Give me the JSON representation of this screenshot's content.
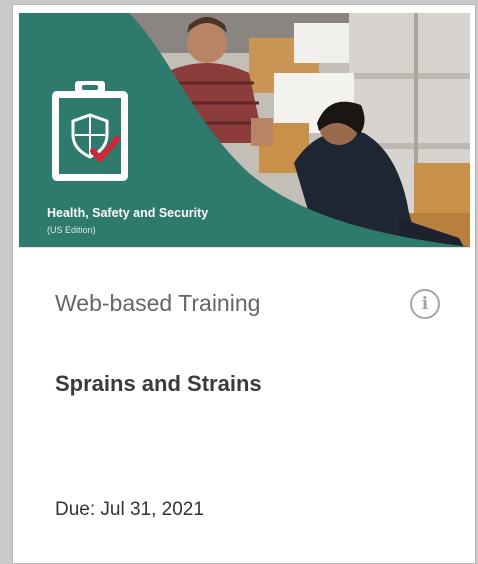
{
  "card": {
    "banner": {
      "title": "Health, Safety and Security",
      "subtitle": "(US Edition)",
      "icon": "clipboard-shield-check-icon",
      "colors": {
        "brand_teal": "#2e7a6c",
        "check_red": "#d0263a"
      }
    },
    "type_label": "Web-based Training",
    "info_icon": {
      "name": "info-icon",
      "glyph": "i"
    },
    "course_title": "Sprains and Strains",
    "due_date": "Due: Jul 31, 2021"
  }
}
